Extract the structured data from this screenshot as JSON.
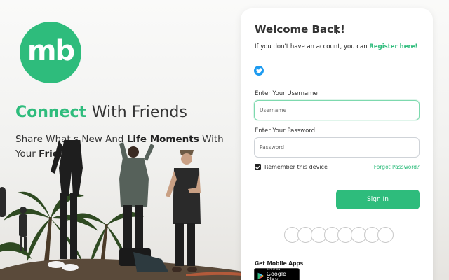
{
  "brand": {
    "logo_text": "mb",
    "accent_color": "#2ebc7c"
  },
  "hero": {
    "headline_accent": "Connect",
    "headline_rest": "With Friends",
    "subline_part1": "Share What",
    "subline_part2": "s New And",
    "subline_bold1": "Life Moments",
    "subline_part3": "With",
    "subline_part4": "Your",
    "subline_bold2": "Frien"
  },
  "login": {
    "title": "Welcome Back!",
    "register_prompt": "If you don't have an account, you can",
    "register_link": "Register here!",
    "social_icon": "twitter-icon",
    "username_label": "Enter Your Username",
    "username_placeholder": "Username",
    "username_value": "",
    "password_label": "Enter Your Password",
    "password_placeholder": "Password",
    "password_value": "",
    "remember_label": "Remember this device",
    "remember_checked": true,
    "forgot_link": "Forgot Password?",
    "signin_button": "Sign In",
    "mobile_title": "Get Mobile Apps",
    "gplay_small": "GET IT ON",
    "gplay_big": "Google Play"
  }
}
